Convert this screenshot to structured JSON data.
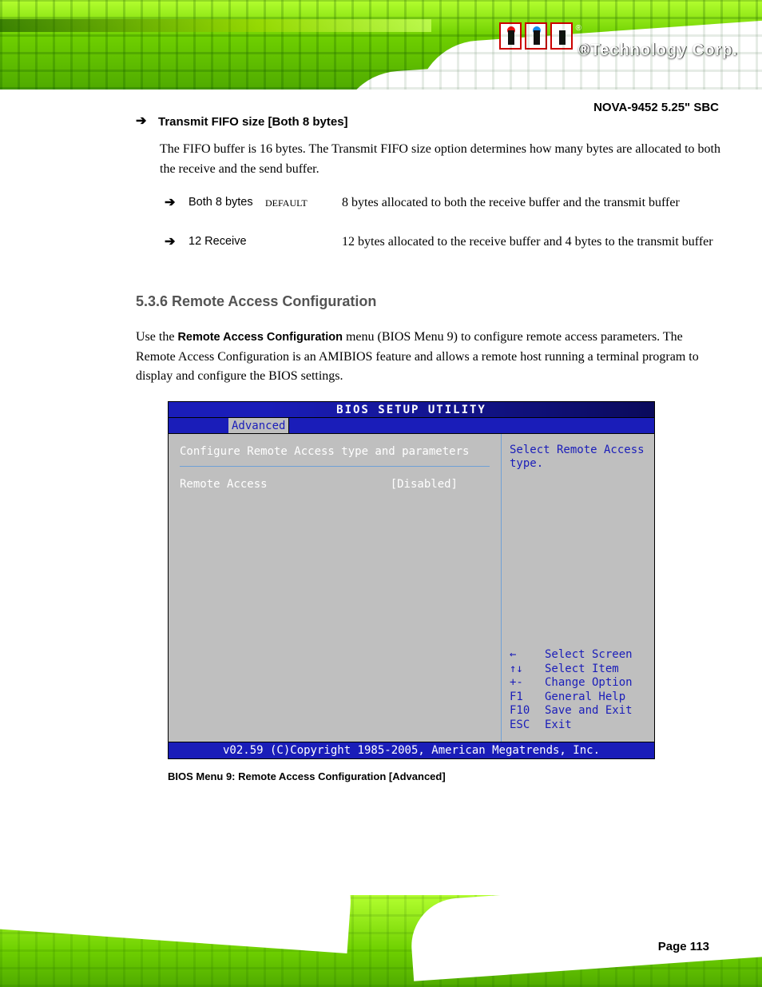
{
  "header": {
    "brand": "®Technology Corp.",
    "product_tag": "NOVA-9452 5.25\" SBC"
  },
  "content": {
    "buffers_option": {
      "title": "Transmit FIFO size [Both 8 bytes]",
      "body": "The FIFO buffer is 16 bytes. The Transmit FIFO size option determines how many bytes are allocated to both the receive and the send buffer.",
      "subopts": [
        {
          "key": "Both 8 bytes",
          "def": "DEFAULT",
          "desc": "8 bytes allocated to both the receive buffer and the transmit buffer"
        },
        {
          "key": "12 Receive",
          "def": "",
          "desc": "12 bytes allocated to the receive buffer and 4 bytes to the transmit buffer"
        }
      ]
    },
    "remote_section": {
      "title": "5.3.6 Remote Access Configuration",
      "desc_prefix": "Use the ",
      "desc_bold": "Remote Access Configuration",
      "desc_suffix": " menu (BIOS Menu 9) to configure remote access parameters. The Remote Access Configuration is an AMIBIOS feature and allows a remote host running a terminal program to display and configure the BIOS settings."
    },
    "bios": {
      "title": "BIOS SETUP UTILITY",
      "active_tab": "Advanced",
      "panel_heading": "Configure Remote Access type and parameters",
      "setting_label": "Remote Access",
      "setting_value": "[Disabled]",
      "help_text": "Select Remote Access type.",
      "keys": [
        {
          "k": "←",
          "d": "Select Screen"
        },
        {
          "k": "↑↓",
          "d": "Select Item"
        },
        {
          "k": "+-",
          "d": "Change Option"
        },
        {
          "k": "F1",
          "d": "General Help"
        },
        {
          "k": "F10",
          "d": "Save and Exit"
        },
        {
          "k": "ESC",
          "d": "Exit"
        }
      ],
      "footer": "v02.59 (C)Copyright 1985-2005, American Megatrends, Inc."
    },
    "caption": "BIOS Menu 9: Remote Access Configuration [Advanced]"
  },
  "footer": {
    "page_label": "Page 113"
  }
}
